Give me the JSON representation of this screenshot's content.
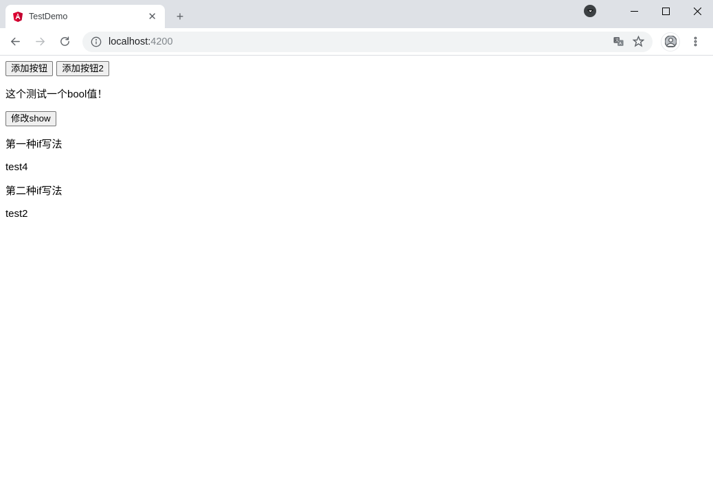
{
  "browser": {
    "tab_title": "TestDemo",
    "url_host": "localhost:",
    "url_port": "4200"
  },
  "page": {
    "btn_add1": "添加按钮",
    "btn_add2": "添加按钮2",
    "text_bool": "这个测试一个bool值！",
    "btn_modify_show": "修改show",
    "heading_if1": "第一种if写法",
    "text_test4": "test4",
    "heading_if2": "第二种if写法",
    "text_test2": "test2"
  }
}
